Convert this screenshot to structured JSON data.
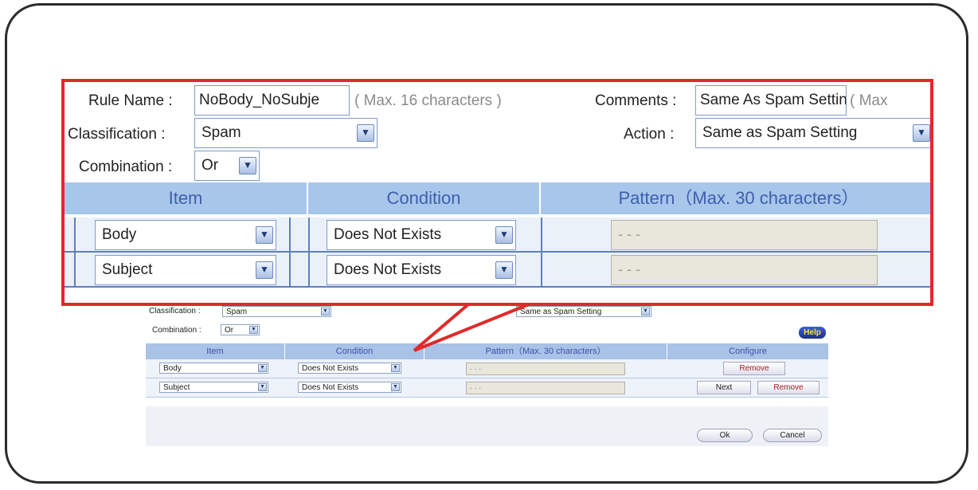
{
  "background_form": {
    "classification": {
      "label": "Classification :",
      "value": "Spam"
    },
    "action": {
      "value": "Same as Spam Setting"
    },
    "combination": {
      "label": "Combination :",
      "value": "Or"
    },
    "help_label": "Help",
    "columns": [
      "Item",
      "Condition",
      "Pattern（Max. 30 characters）",
      "Configure"
    ],
    "rows": [
      {
        "item": "Body",
        "condition": "Does Not Exists",
        "pattern": "- - -",
        "buttons": [
          "Remove"
        ]
      },
      {
        "item": "Subject",
        "condition": "Does Not Exists",
        "pattern": "- - -",
        "buttons": [
          "Next",
          "Remove"
        ]
      }
    ],
    "ok_label": "Ok",
    "cancel_label": "Cancel"
  },
  "zoom_form": {
    "rule_name": {
      "label": "Rule Name :",
      "value": "NoBody_NoSubje",
      "hint": "( Max. 16 characters )"
    },
    "comments": {
      "label": "Comments :",
      "value": "Same As Spam Settin",
      "hint": "( Max"
    },
    "classification": {
      "label": "Classification :",
      "value": "Spam"
    },
    "action": {
      "label": "Action :",
      "value": "Same as Spam Setting"
    },
    "combination": {
      "label": "Combination :",
      "value": "Or"
    },
    "columns": [
      "Item",
      "Condition",
      "Pattern（Max. 30 characters）"
    ],
    "rows": [
      {
        "item": "Body",
        "condition": "Does Not Exists",
        "pattern": "- - -"
      },
      {
        "item": "Subject",
        "condition": "Does Not Exists",
        "pattern": "- - -"
      }
    ]
  },
  "colors": {
    "callout_border": "#e12a2a",
    "header_bg": "#a8c6ea",
    "header_text": "#3d5fae"
  },
  "icons": {
    "dropdown": "chevron-down-icon"
  }
}
